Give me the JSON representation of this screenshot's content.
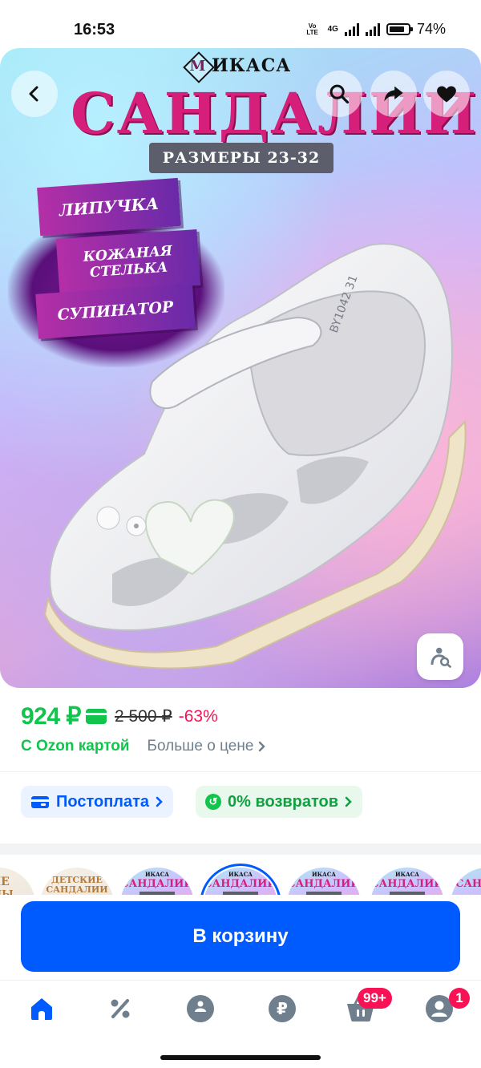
{
  "status_bar": {
    "time": "16:53",
    "network": "4G",
    "volte": "Vo LTE",
    "battery": "74%"
  },
  "hero": {
    "brand": "ИКАСА",
    "brand_logo_letter": "М",
    "title": "САНДАЛИИ",
    "sizes_label": "РАЗМЕРЫ 23-32",
    "tags": [
      "ЛИПУЧКА",
      "КОЖАНАЯ СТЕЛЬКА",
      "СУПИНАТОР"
    ],
    "shoe_code": "BY1042 31",
    "icons": {
      "back": "chevron-left-icon",
      "search": "search-icon",
      "share": "share-icon",
      "favorite": "heart-icon",
      "visual_search": "image-search-icon"
    }
  },
  "price": {
    "current": "924 ₽",
    "old": "2 500 ₽",
    "discount": "-63%",
    "ozon_card": "С Ozon картой",
    "more": "Больше о цене"
  },
  "chips": {
    "postpay": "Постоплата",
    "returns": "0% возвратов"
  },
  "thumbnails": [
    {
      "title": "ЫЕ",
      "sub": "ИЦЫ",
      "kind": "kids"
    },
    {
      "title": "ДЕТСКИЕ САНДАЛИИ",
      "kind": "kids"
    },
    {
      "brand": "ИКАСА",
      "title": "САНДАЛИИ"
    },
    {
      "brand": "ИКАСА",
      "title": "САНДАЛИИ",
      "active": true
    },
    {
      "brand": "ИКАСА",
      "title": "САНДАЛИИ"
    },
    {
      "brand": "ИКАСА",
      "title": "САНДАЛИИ"
    },
    {
      "title": "САН"
    }
  ],
  "cart_button": "В корзину",
  "bottom_nav": {
    "items": [
      "home-icon",
      "percent-icon",
      "fresh-icon",
      "points-icon",
      "cart-icon",
      "profile-icon"
    ],
    "cart_badge": "99+",
    "profile_badge": "1"
  },
  "colors": {
    "accent": "#005bff",
    "price_green": "#10c44c",
    "discount_red": "#f91155",
    "nav_icon": "#707f8d"
  }
}
